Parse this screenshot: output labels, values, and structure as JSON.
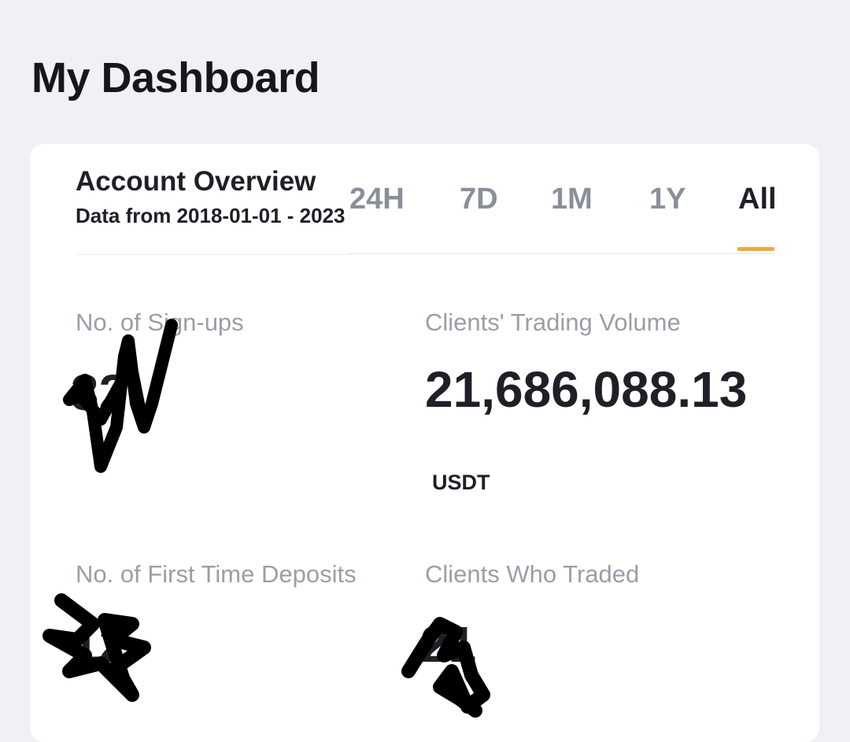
{
  "page": {
    "title": "My Dashboard"
  },
  "overview": {
    "title": "Account Overview",
    "date_range": "Data from 2018-01-01 - 2023"
  },
  "tabs": [
    {
      "label": "24H",
      "active": false
    },
    {
      "label": "7D",
      "active": false
    },
    {
      "label": "1M",
      "active": false
    },
    {
      "label": "1Y",
      "active": false
    },
    {
      "label": "All",
      "active": true
    }
  ],
  "stats": {
    "signups": {
      "label": "No. of Sign-ups",
      "value": "32"
    },
    "trading_volume": {
      "label": "Clients' Trading Volume",
      "value": "21,686,088.13",
      "unit": "USDT"
    },
    "first_deposits": {
      "label": "No. of First Time Deposits",
      "value": "12"
    },
    "clients_traded": {
      "label": "Clients Who Traded",
      "value": "21"
    }
  },
  "colors": {
    "background": "#f0f1f5",
    "card": "#ffffff",
    "accent": "#f0a73b",
    "text_primary": "#1e2026",
    "text_secondary": "#9a9ea7",
    "redaction": "#000000"
  }
}
